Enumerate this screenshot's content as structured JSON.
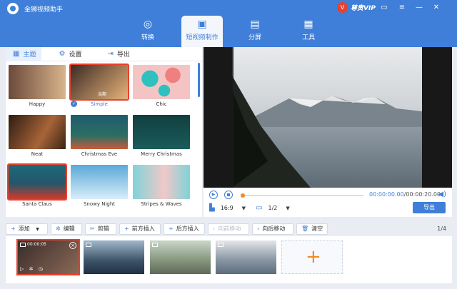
{
  "app": {
    "title": "金狮视频助手",
    "vip_label": "尊贵VIP",
    "vip_badge": "V"
  },
  "window_controls": {
    "message": "▭",
    "menu": "≡",
    "minimize": "—",
    "close": "✕"
  },
  "main_tabs": [
    {
      "label": "转换",
      "icon": "convert-icon",
      "glyph": "◎"
    },
    {
      "label": "短视频制作",
      "icon": "short-video-icon",
      "glyph": "▣"
    },
    {
      "label": "分屏",
      "icon": "split-screen-icon",
      "glyph": "▤"
    },
    {
      "label": "工具",
      "icon": "toolbox-icon",
      "glyph": "▦"
    }
  ],
  "sub_tabs": [
    {
      "label": "主题",
      "icon": "grid-icon",
      "glyph": "▦"
    },
    {
      "label": "设置",
      "icon": "gear-icon",
      "glyph": "⚙"
    },
    {
      "label": "导出",
      "icon": "export-icon",
      "glyph": "⇥"
    }
  ],
  "themes": [
    {
      "name": "Happy",
      "colors": [
        "#6b4a3a",
        "#d9b48c"
      ]
    },
    {
      "name": "Simple",
      "colors": [
        "#3b2b24",
        "#e7b27a"
      ],
      "overlay": "当期"
    },
    {
      "name": "Chic",
      "colors": [
        "#f4c4c4",
        "#2fc0c0"
      ]
    },
    {
      "name": "Neat",
      "colors": [
        "#2e1c12",
        "#a86438"
      ]
    },
    {
      "name": "Christmas Eve",
      "colors": [
        "#1f5b6e",
        "#c85b3a"
      ]
    },
    {
      "name": "Merry Christmas",
      "colors": [
        "#123f3f",
        "#1a5c5a"
      ]
    },
    {
      "name": "Santa Claus",
      "colors": [
        "#1d6a78",
        "#d13a2a"
      ]
    },
    {
      "name": "Snowy Night",
      "colors": [
        "#5aa8d8",
        "#d8eef8"
      ]
    },
    {
      "name": "Stripes & Waves",
      "colors": [
        "#7fd3d8",
        "#f2c8c8"
      ]
    }
  ],
  "playback": {
    "current": "00:00:00.00",
    "separator": "/",
    "total": "00:00:20.00",
    "aspect": "16:9",
    "layout": "1/2",
    "export_label": "导出",
    "progress": 0
  },
  "toolbar": [
    {
      "label": "添加",
      "icon": "plus-icon",
      "glyph": "+",
      "has_dropdown": true,
      "disabled": false
    },
    {
      "label": "编辑",
      "icon": "magic-wand-icon",
      "glyph": "✲",
      "disabled": false
    },
    {
      "label": "剪辑",
      "icon": "scissors-icon",
      "glyph": "✂",
      "disabled": false
    },
    {
      "label": "前方插入",
      "icon": "insert-before-icon",
      "glyph": "+",
      "disabled": false
    },
    {
      "label": "后方插入",
      "icon": "insert-after-icon",
      "glyph": "+",
      "disabled": false
    },
    {
      "label": "向前移动",
      "icon": "move-forward-icon",
      "glyph": "‹",
      "disabled": true
    },
    {
      "label": "向后移动",
      "icon": "move-backward-icon",
      "glyph": "›",
      "disabled": false
    },
    {
      "label": "清空",
      "icon": "trash-icon",
      "glyph": "🗑",
      "disabled": false
    }
  ],
  "page_indicator": "1/4",
  "clips": [
    {
      "time": "00:00:05",
      "colors": [
        "#3a2b28",
        "#8a6a58"
      ]
    },
    {
      "colors": [
        "#1f3044",
        "#9fb7cc"
      ]
    },
    {
      "colors": [
        "#5e6a58",
        "#c9d6c9"
      ]
    },
    {
      "colors": [
        "#5b6c7d",
        "#e3e6e8"
      ]
    }
  ]
}
